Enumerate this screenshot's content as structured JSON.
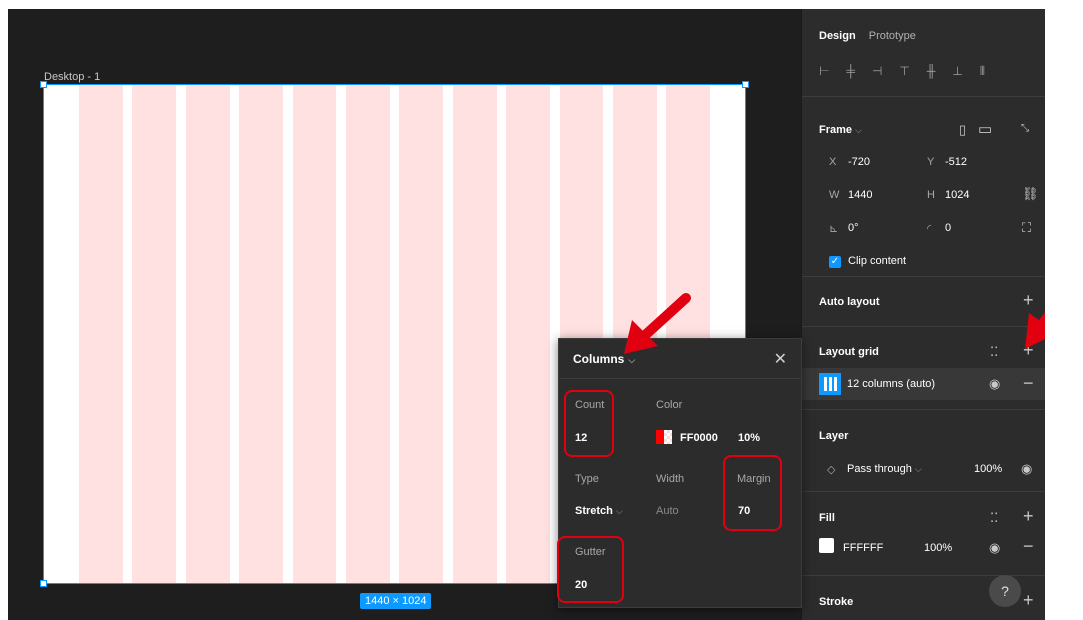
{
  "canvas": {
    "frame_label": "Desktop - 1",
    "size_badge": "1440 × 1024"
  },
  "popover": {
    "title": "Columns",
    "count_label": "Count",
    "count_value": "12",
    "color_label": "Color",
    "color_hex": "FF0000",
    "color_opacity": "10%",
    "type_label": "Type",
    "type_value": "Stretch",
    "width_label": "Width",
    "width_value": "Auto",
    "margin_label": "Margin",
    "margin_value": "70",
    "gutter_label": "Gutter",
    "gutter_value": "20"
  },
  "panel": {
    "tab_design": "Design",
    "tab_prototype": "Prototype",
    "frame": {
      "title": "Frame",
      "x_label": "X",
      "x_value": "-720",
      "y_label": "Y",
      "y_value": "-512",
      "w_label": "W",
      "w_value": "1440",
      "h_label": "H",
      "h_value": "1024",
      "rotation": "0°",
      "radius": "0",
      "clip_label": "Clip content"
    },
    "auto_layout": {
      "title": "Auto layout"
    },
    "layout_grid": {
      "title": "Layout grid",
      "item_label": "12 columns (auto)"
    },
    "layer": {
      "title": "Layer",
      "blend": "Pass through",
      "opacity": "100%"
    },
    "fill": {
      "title": "Fill",
      "hex": "FFFFFF",
      "opacity": "100%"
    },
    "stroke": {
      "title": "Stroke"
    },
    "help": "?"
  },
  "colors": {
    "accent": "#0d99ff",
    "grid_column": "#ffe1e1",
    "annotation": "#e0000f",
    "panel_bg": "#2c2c2c",
    "canvas_bg": "#1e1e1e"
  }
}
